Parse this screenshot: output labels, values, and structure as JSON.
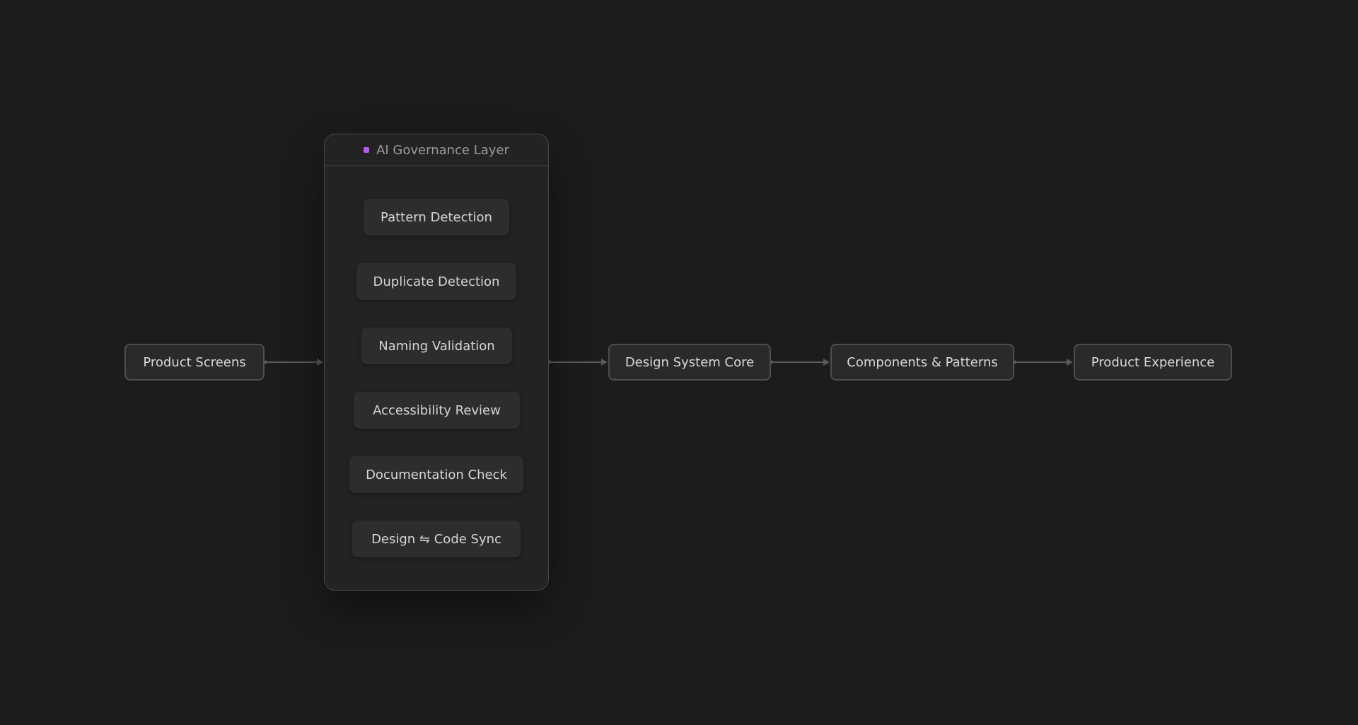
{
  "colors": {
    "background": "#1c1c1c",
    "node_fill": "#2a2a2a",
    "node_border": "#4e4e4e",
    "connector": "#5a5a5a",
    "governance_marker": "#b45cf0"
  },
  "diagram": {
    "input": {
      "label": "Product Screens"
    },
    "governance_layer": {
      "title": "AI Governance Layer",
      "checks": [
        {
          "label": "Pattern Detection"
        },
        {
          "label": "Duplicate Detection"
        },
        {
          "label": "Naming Validation"
        },
        {
          "label": "Accessibility Review"
        },
        {
          "label": "Documentation Check"
        },
        {
          "label": "Design ⇋ Code Sync"
        }
      ]
    },
    "pipeline": [
      {
        "label": "Design System Core"
      },
      {
        "label": "Components & Patterns"
      },
      {
        "label": "Product Experience"
      }
    ],
    "edges": [
      {
        "from": "Product Screens",
        "to": "AI Governance Layer"
      },
      {
        "from": "AI Governance Layer",
        "to": "Design System Core"
      },
      {
        "from": "Design System Core",
        "to": "Components & Patterns"
      },
      {
        "from": "Components & Patterns",
        "to": "Product Experience"
      }
    ]
  }
}
